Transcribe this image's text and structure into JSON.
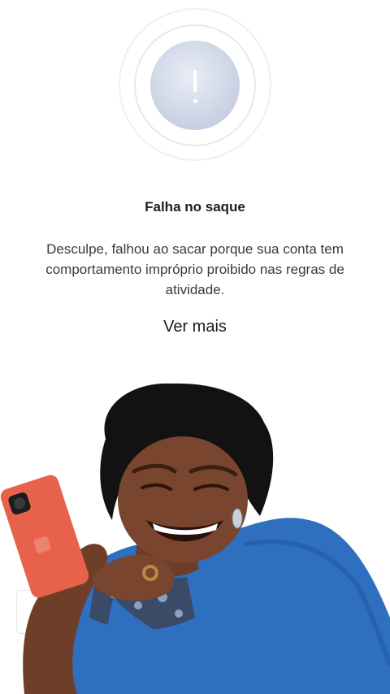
{
  "dialog": {
    "title": "Falha no saque",
    "message": "Desculpe, falhou ao sacar porque sua conta tem comportamento impróprio proibido nas regras de atividade.",
    "more_label": "Ver mais",
    "status_icon": "exclamation-icon"
  },
  "overlay": {
    "kind": "laughing-woman-with-phone-sticker",
    "phone_color": "#e8614a",
    "shirt_color": "#2f6fc0"
  }
}
